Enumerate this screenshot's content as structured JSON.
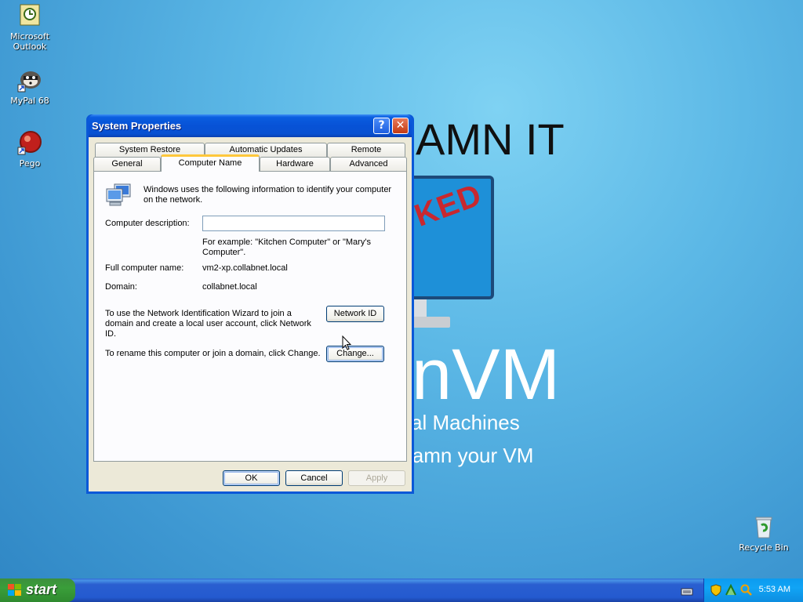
{
  "desktop": {
    "icons": [
      {
        "label": "Microsoft Outlook"
      },
      {
        "label": "MyPal 68"
      },
      {
        "label": "Pego"
      },
      {
        "label": "Recycle Bin"
      }
    ],
    "wallpaper": {
      "title": "AMN IT",
      "stamp": "KED",
      "brand": "nVM",
      "line1": "al Machines",
      "line2": "lamn your VM"
    }
  },
  "window": {
    "title": "System Properties",
    "help_symbol": "?",
    "close_symbol": "✕",
    "tabs_row1": [
      "System Restore",
      "Automatic Updates",
      "Remote"
    ],
    "tabs_row2": [
      "General",
      "Computer Name",
      "Hardware",
      "Advanced"
    ],
    "active_tab": "Computer Name",
    "intro": "Windows uses the following information to identify your computer on the network.",
    "description_label": "Computer description:",
    "description_value": "",
    "example_text": "For example: \"Kitchen Computer\" or \"Mary's Computer\".",
    "full_name_label": "Full computer name:",
    "full_name_value": "vm2-xp.collabnet.local",
    "domain_label": "Domain:",
    "domain_value": "collabnet.local",
    "network_id_text": "To use the Network Identification Wizard to join a domain and create a local user account, click Network ID.",
    "network_id_button": "Network ID",
    "rename_text": "To rename this computer or join a domain, click Change.",
    "change_button": "Change...",
    "ok_button": "OK",
    "cancel_button": "Cancel",
    "apply_button": "Apply"
  },
  "taskbar": {
    "start_label": "start",
    "clock": "5:53 AM"
  },
  "colors": {
    "titlebar": "#0752d6",
    "active_tab_accent": "#ffc83c",
    "start_green": "#3a9e3a",
    "tray_blue": "#11a4f5"
  }
}
